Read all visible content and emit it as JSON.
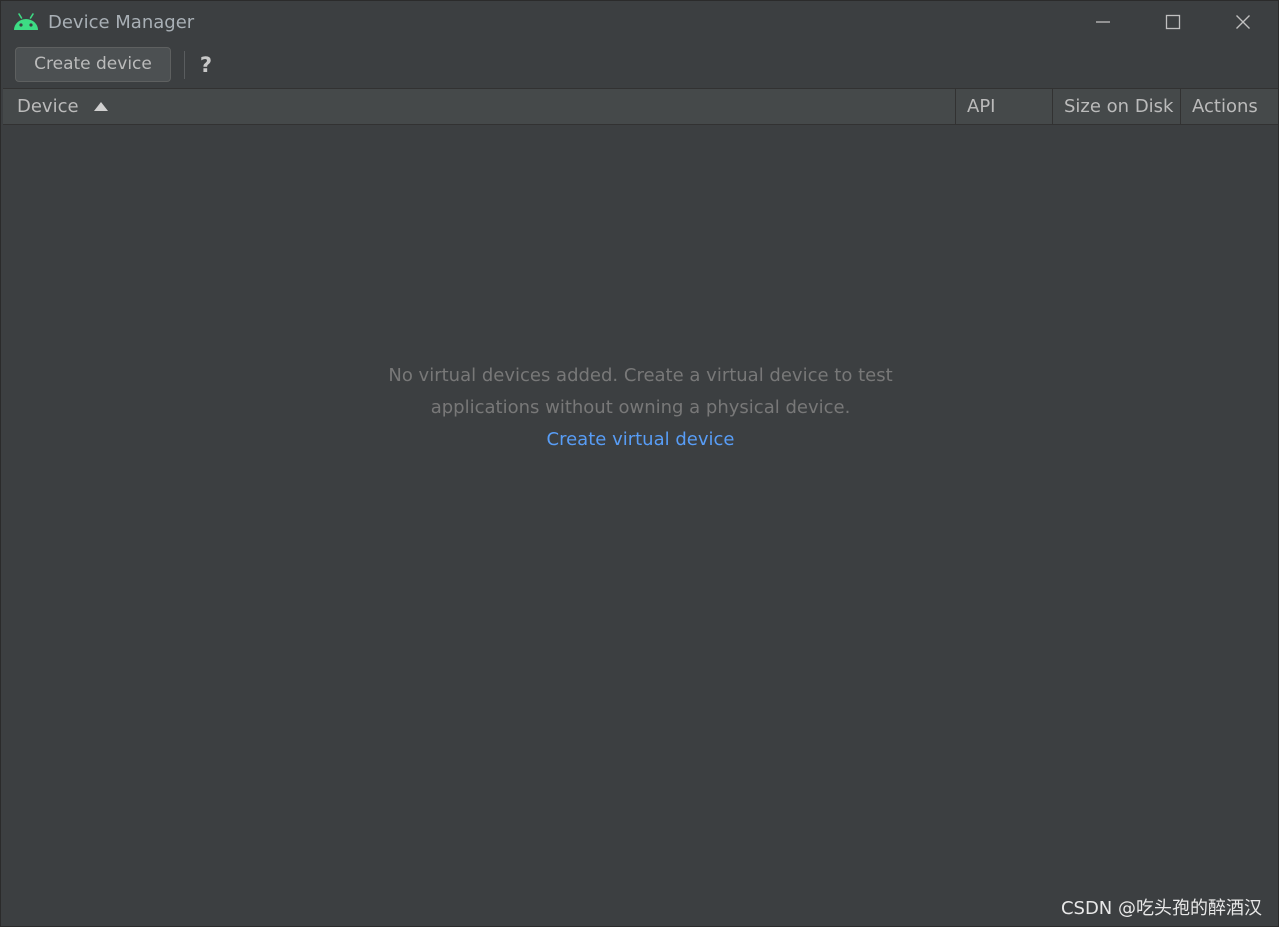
{
  "window": {
    "title": "Device Manager"
  },
  "toolbar": {
    "create_device_label": "Create device",
    "help_label": "?"
  },
  "table": {
    "columns": [
      "Device",
      "API",
      "Size on Disk",
      "Actions"
    ],
    "sort_column": "Device",
    "sort_direction": "ascending"
  },
  "empty_state": {
    "line1": "No virtual devices added. Create a virtual device to test",
    "line2": "applications without owning a physical device.",
    "link_label": "Create virtual device"
  },
  "watermark": "CSDN @吃头孢的醉酒汉",
  "icons": {
    "app": "android-icon",
    "minimize": "minimize-icon",
    "maximize": "maximize-icon",
    "close": "close-icon",
    "sort": "sort-ascending-icon"
  },
  "colors": {
    "background": "#3c3f41",
    "header_background": "#45494a",
    "text": "#bbbbbb",
    "muted_text": "#787878",
    "link": "#589df6",
    "android_green": "#3ddc84"
  }
}
